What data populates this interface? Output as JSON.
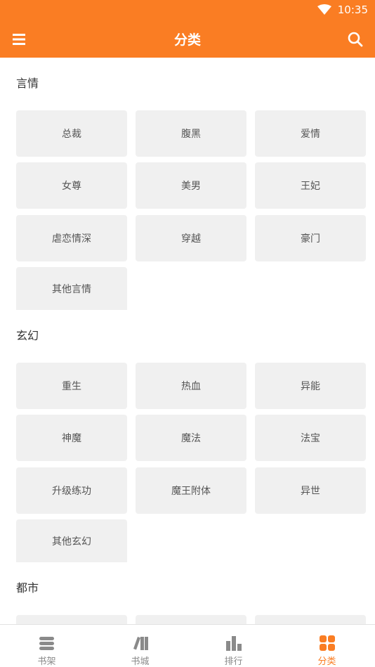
{
  "status": {
    "time": "10:35"
  },
  "header": {
    "title": "分类"
  },
  "sections": [
    {
      "title": "言情",
      "tags": [
        "总裁",
        "腹黑",
        "爱情",
        "女尊",
        "美男",
        "王妃",
        "虐恋情深",
        "穿越",
        "豪门",
        "其他言情"
      ]
    },
    {
      "title": "玄幻",
      "tags": [
        "重生",
        "热血",
        "异能",
        "神魔",
        "魔法",
        "法宝",
        "升级练功",
        "魔王附体",
        "异世",
        "其他玄幻"
      ]
    },
    {
      "title": "都市",
      "tags": []
    }
  ],
  "nav": {
    "items": [
      {
        "label": "书架",
        "icon": "bookshelf-icon"
      },
      {
        "label": "书城",
        "icon": "bookstore-icon"
      },
      {
        "label": "排行",
        "icon": "ranking-icon"
      },
      {
        "label": "分类",
        "icon": "category-icon",
        "active": true
      }
    ]
  },
  "colors": {
    "accent": "#fa7d23",
    "tag_bg": "#f0f0f0",
    "text": "#333333",
    "nav_inactive": "#8a8a8a"
  }
}
